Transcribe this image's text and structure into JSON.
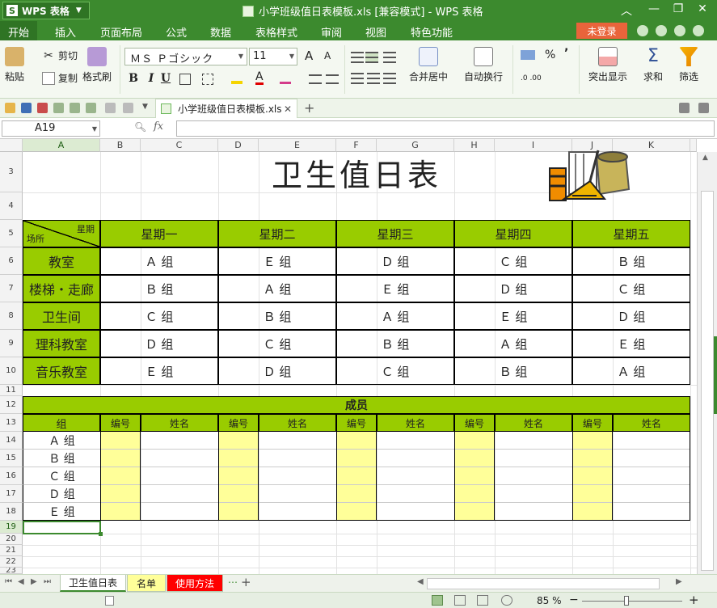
{
  "app": {
    "app_button": "WPS 表格",
    "logo_letter": "S",
    "doc_title": "小学班级值日表模板.xls [兼容模式] - WPS 表格"
  },
  "menu": {
    "items": [
      "开始",
      "插入",
      "页面布局",
      "公式",
      "数据",
      "表格样式",
      "审阅",
      "视图",
      "特色功能"
    ],
    "login": "未登录"
  },
  "ribbon": {
    "paste": "粘贴",
    "cut": "剪切",
    "copy": "复制",
    "format_painter": "格式刷",
    "font_name": "ＭＳ Ｐゴシック",
    "font_size": "11",
    "bold": "B",
    "italic": "I",
    "underline": "U",
    "grow_font": "A",
    "shrink_font": "A",
    "merge_center": "合并居中",
    "wrap_text": "自动换行",
    "percent": "%",
    "comma": "’",
    "highlight": "突出显示",
    "sum": "求和",
    "filter": "筛选"
  },
  "doc_tab": {
    "label": "小学班级值日表模板.xls"
  },
  "formula_bar": {
    "cell_ref": "A19",
    "fx": "fx",
    "value": ""
  },
  "columns": [
    "A",
    "B",
    "C",
    "D",
    "E",
    "F",
    "G",
    "H",
    "I",
    "J",
    "K"
  ],
  "rows": [
    "3",
    "4",
    "5",
    "6",
    "7",
    "8",
    "9",
    "10",
    "11",
    "12",
    "13",
    "14",
    "15",
    "16",
    "17",
    "18",
    "19",
    "20",
    "21",
    "22",
    "23"
  ],
  "sheet": {
    "title": "卫生值日表",
    "corner_top": "星期",
    "corner_bottom": "场所",
    "days": [
      "星期一",
      "星期二",
      "星期三",
      "星期四",
      "星期五"
    ],
    "schedule": [
      {
        "place": "教室",
        "groups": [
          "Ａ 组",
          "Ｅ 组",
          "Ｄ 组",
          "Ｃ 组",
          "Ｂ 组"
        ]
      },
      {
        "place": "楼梯・走廊",
        "groups": [
          "Ｂ 组",
          "Ａ 组",
          "Ｅ 组",
          "Ｄ 组",
          "Ｃ 组"
        ]
      },
      {
        "place": "卫生间",
        "groups": [
          "Ｃ 组",
          "Ｂ 组",
          "Ａ 组",
          "Ｅ 组",
          "Ｄ 组"
        ]
      },
      {
        "place": "理科教室",
        "groups": [
          "Ｄ 组",
          "Ｃ 组",
          "Ｂ 组",
          "Ａ 组",
          "Ｅ 组"
        ]
      },
      {
        "place": "音乐教室",
        "groups": [
          "Ｅ 组",
          "Ｄ 组",
          "Ｃ 组",
          "Ｂ 组",
          "Ａ 组"
        ]
      }
    ],
    "members_title": "成员",
    "group_header": "组",
    "number_header": "编号",
    "name_header": "姓名",
    "member_groups": [
      "Ａ 组",
      "Ｂ 组",
      "Ｃ 组",
      "Ｄ 组",
      "Ｅ 组"
    ]
  },
  "sheet_tabs": [
    {
      "label": "卫生值日表",
      "bg": "#ffffff",
      "color": "#222222"
    },
    {
      "label": "名单",
      "bg": "#ffff99",
      "color": "#222222"
    },
    {
      "label": "使用方法",
      "bg": "#ff0000",
      "color": "#ffffff"
    }
  ],
  "status": {
    "zoom": "85 %"
  },
  "colors": {
    "brand": "#3c8a2e",
    "header_green": "#99cc00",
    "id_yellow": "#ffff99"
  }
}
